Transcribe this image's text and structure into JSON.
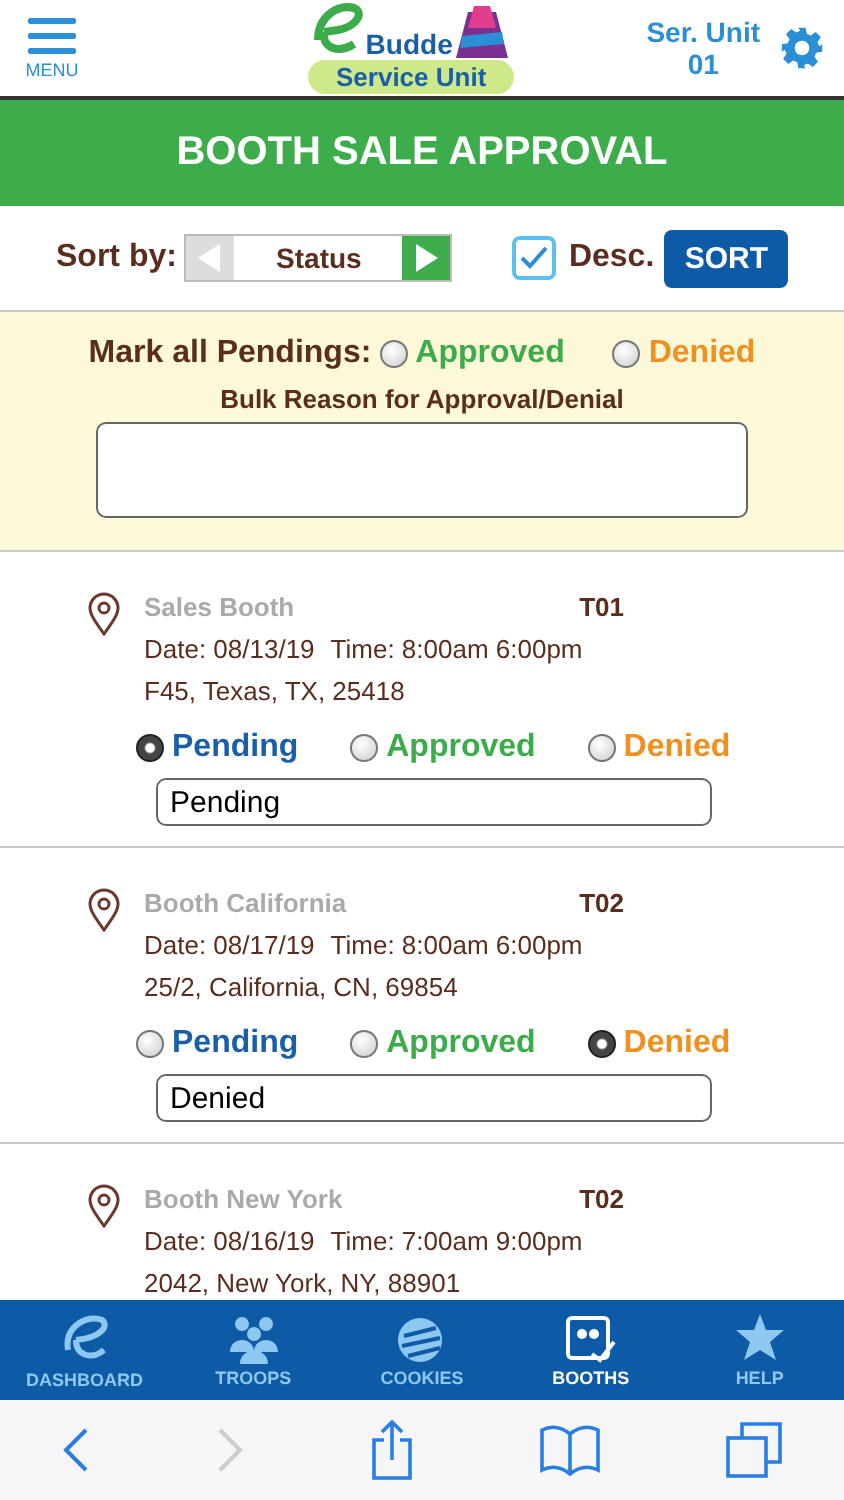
{
  "header": {
    "menu_label": "MENU",
    "logo_word": "Budde",
    "logo_badge": "Service Unit",
    "unit": "Ser. Unit",
    "unit_number": "01"
  },
  "title": "BOOTH SALE APPROVAL",
  "sort": {
    "label": "Sort by:",
    "value": "Status",
    "prev_disabled": true,
    "next_disabled": false,
    "desc_label": "Desc.",
    "desc_checked": true,
    "button": "SORT"
  },
  "bulk": {
    "label": "Mark all Pendings:",
    "options": [
      {
        "label": "Approved",
        "kind": "approved",
        "selected": false
      },
      {
        "label": "Denied",
        "kind": "denied",
        "selected": false
      }
    ],
    "reason_label": "Bulk Reason for Approval/Denial"
  },
  "booths": [
    {
      "name": "Sales Booth",
      "troop": "T01",
      "date": "Date: 08/13/19",
      "time": "Time: 8:00am 6:00pm",
      "address": "F45, Texas, TX, 25418",
      "options": [
        {
          "label": "Pending",
          "kind": "pending",
          "selected": true
        },
        {
          "label": "Approved",
          "kind": "approved",
          "selected": false
        },
        {
          "label": "Denied",
          "kind": "denied",
          "selected": false
        }
      ],
      "reason": "Pending"
    },
    {
      "name": "Booth California",
      "troop": "T02",
      "date": "Date: 08/17/19",
      "time": "Time: 8:00am 6:00pm",
      "address": "25/2, California, CN, 69854",
      "options": [
        {
          "label": "Pending",
          "kind": "pending",
          "selected": false
        },
        {
          "label": "Approved",
          "kind": "approved",
          "selected": false
        },
        {
          "label": "Denied",
          "kind": "denied",
          "selected": true
        }
      ],
      "reason": "Denied"
    },
    {
      "name": "Booth New York",
      "troop": "T02",
      "date": "Date: 08/16/19",
      "time": "Time: 7:00am 9:00pm",
      "address": "2042, New York, NY, 88901"
    }
  ],
  "tabs": [
    {
      "label": "DASHBOARD",
      "selected": false
    },
    {
      "label": "TROOPS",
      "selected": false
    },
    {
      "label": "COOKIES",
      "selected": false
    },
    {
      "label": "BOOTHS",
      "selected": true
    },
    {
      "label": "HELP",
      "selected": false
    }
  ],
  "browser": [
    {
      "kind": "back",
      "disabled": false
    },
    {
      "kind": "forward",
      "disabled": true
    },
    {
      "kind": "share",
      "disabled": false
    },
    {
      "kind": "bookmarks",
      "disabled": false
    },
    {
      "kind": "tabs",
      "disabled": false
    }
  ]
}
